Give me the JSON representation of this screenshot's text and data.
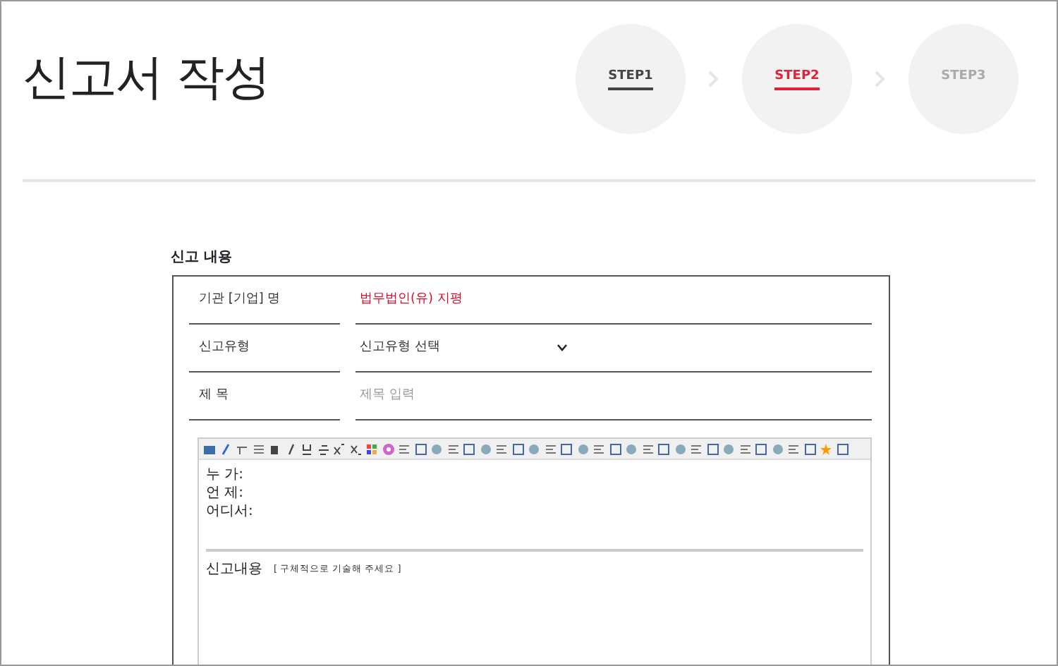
{
  "page_title": "신고서 작성",
  "steps": [
    {
      "label": "STEP1",
      "kind": "done"
    },
    {
      "label": "STEP2",
      "kind": "current"
    },
    {
      "label": "STEP3",
      "kind": "todo"
    }
  ],
  "section_title": "신고 내용",
  "form_rows": [
    {
      "label": "기관 [기업] 명",
      "kind": "static",
      "value": "법무법인(유) 지평"
    },
    {
      "label": "신고유형",
      "kind": "select",
      "value": "신고유형 선택"
    },
    {
      "label": "제 목",
      "kind": "input",
      "placeholder": "제목 입력"
    }
  ],
  "editor": {
    "lines": [
      "누 가:",
      "언 제:",
      "어디서:"
    ],
    "heading": "신고내용",
    "hint": "[ 구체적으로 기술해 주세요 ]"
  }
}
